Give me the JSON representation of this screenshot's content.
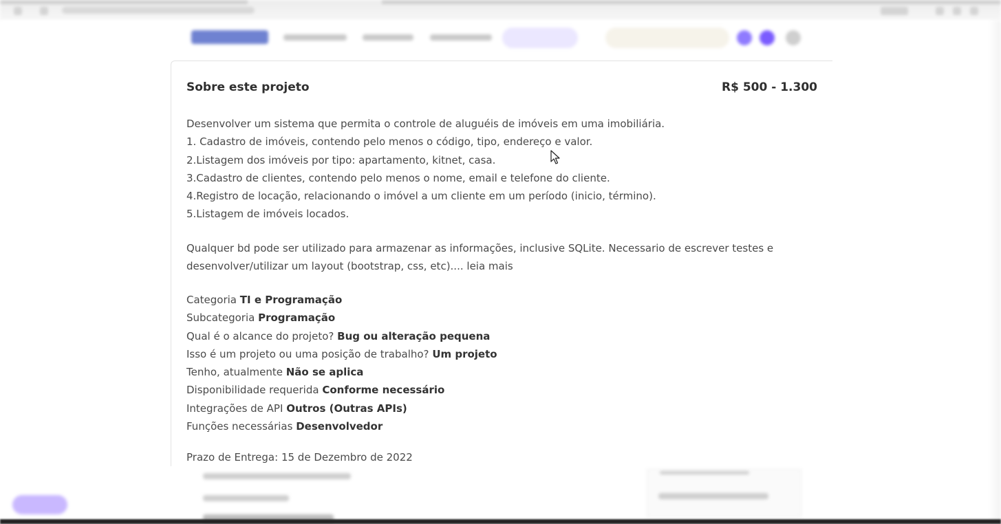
{
  "project": {
    "title": "Sobre este projeto",
    "price": "R$ 500 - 1.300",
    "description_lines": [
      "Desenvolver um sistema que permita o controle de aluguéis de imóveis em uma imobiliária.",
      "1. Cadastro de imóveis, contendo pelo menos o código, tipo, endereço e valor.",
      "2.Listagem dos imóveis por tipo: apartamento, kitnet, casa.",
      "3.Cadastro de clientes, contendo pelo menos o nome, email e telefone do cliente.",
      "4.Registro de locação, relacionando o imóvel a um cliente em um período (inicio, término).",
      "5.Listagem de imóveis locados."
    ],
    "paragraph2": "Qualquer bd pode ser utilizado para armazenar as informações, inclusive SQLite. Necessario de escrever testes e desenvolver/utilizar um layout (bootstrap, css, etc)....",
    "read_more": "leia mais",
    "details": [
      {
        "label": "Categoria",
        "value": "TI e Programação"
      },
      {
        "label": "Subcategoria",
        "value": "Programação"
      },
      {
        "label": "Qual é o alcance do projeto?",
        "value": "Bug ou alteração pequena"
      },
      {
        "label": "Isso é um projeto ou uma posição de trabalho?",
        "value": "Um projeto"
      },
      {
        "label": "Tenho, atualmente",
        "value": "Não se aplica"
      },
      {
        "label": "Disponibilidade requerida",
        "value": "Conforme necessário"
      },
      {
        "label": "Integrações de API",
        "value": "Outros (Outras APIs)"
      },
      {
        "label": "Funções necessárias",
        "value": "Desenvolvedor"
      }
    ],
    "deadline": "Prazo de Entrega: 15 de Dezembro de 2022"
  },
  "colors": {
    "brand": "#4b63c6",
    "accent": "#7b5cff",
    "text": "#4a4a4a"
  },
  "icons": {
    "cursor": "mouse-pointer-icon"
  }
}
